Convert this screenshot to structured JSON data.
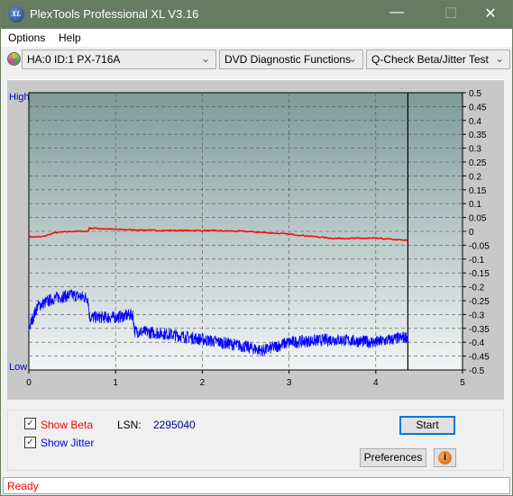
{
  "window": {
    "title": "PlexTools Professional XL V3.16",
    "logo_text": "XL",
    "minimize": "—",
    "maximize": "☐",
    "close": "✕"
  },
  "menu": [
    {
      "label": "Options"
    },
    {
      "label": "Help"
    }
  ],
  "toolbar": {
    "drive": "HA:0 ID:1  PX-716A",
    "function_group": "DVD Diagnostic Functions",
    "test": "Q-Check Beta/Jitter Test"
  },
  "chart_data": {
    "type": "line",
    "y_left_labels": {
      "top": "High",
      "bottom": "Low"
    },
    "xlim": [
      0,
      5
    ],
    "ylim": [
      -0.5,
      0.5
    ],
    "x_ticks": [
      "0",
      "1",
      "2",
      "3",
      "4",
      "5"
    ],
    "y_ticks": [
      "0.5",
      "0.45",
      "0.4",
      "0.35",
      "0.3",
      "0.25",
      "0.2",
      "0.15",
      "0.1",
      "0.05",
      "0",
      "-0.05",
      "-0.1",
      "-0.15",
      "-0.2",
      "-0.25",
      "-0.3",
      "-0.35",
      "-0.4",
      "-0.45",
      "-0.5"
    ],
    "grid": true,
    "marker_x": 4.37,
    "series": [
      {
        "name": "Beta",
        "color": "#ff0000",
        "x": [
          0,
          0.15,
          0.3,
          0.5,
          0.68,
          0.7,
          1.0,
          1.5,
          2.0,
          2.5,
          3.0,
          3.5,
          4.0,
          4.37
        ],
        "y": [
          -0.02,
          -0.02,
          -0.005,
          0.0,
          0.0,
          0.012,
          0.007,
          0.003,
          0.003,
          0.0,
          -0.01,
          -0.025,
          -0.025,
          -0.033
        ]
      },
      {
        "name": "Jitter",
        "color": "#0000ff",
        "x": [
          0,
          0.1,
          0.3,
          0.5,
          0.68,
          0.7,
          1.0,
          1.2,
          1.22,
          1.6,
          2.0,
          2.4,
          2.7,
          3.0,
          3.5,
          4.0,
          4.37
        ],
        "y": [
          -0.35,
          -0.27,
          -0.24,
          -0.23,
          -0.24,
          -0.31,
          -0.31,
          -0.3,
          -0.36,
          -0.37,
          -0.39,
          -0.41,
          -0.43,
          -0.4,
          -0.39,
          -0.4,
          -0.38
        ]
      }
    ]
  },
  "controls": {
    "show_beta": "Show Beta",
    "show_jitter": "Show Jitter",
    "show_beta_checked": true,
    "show_jitter_checked": true,
    "lsn_label": "LSN:",
    "lsn_value": "2295040",
    "start": "Start",
    "preferences": "Preferences",
    "info_icon": "i"
  },
  "status": "Ready"
}
